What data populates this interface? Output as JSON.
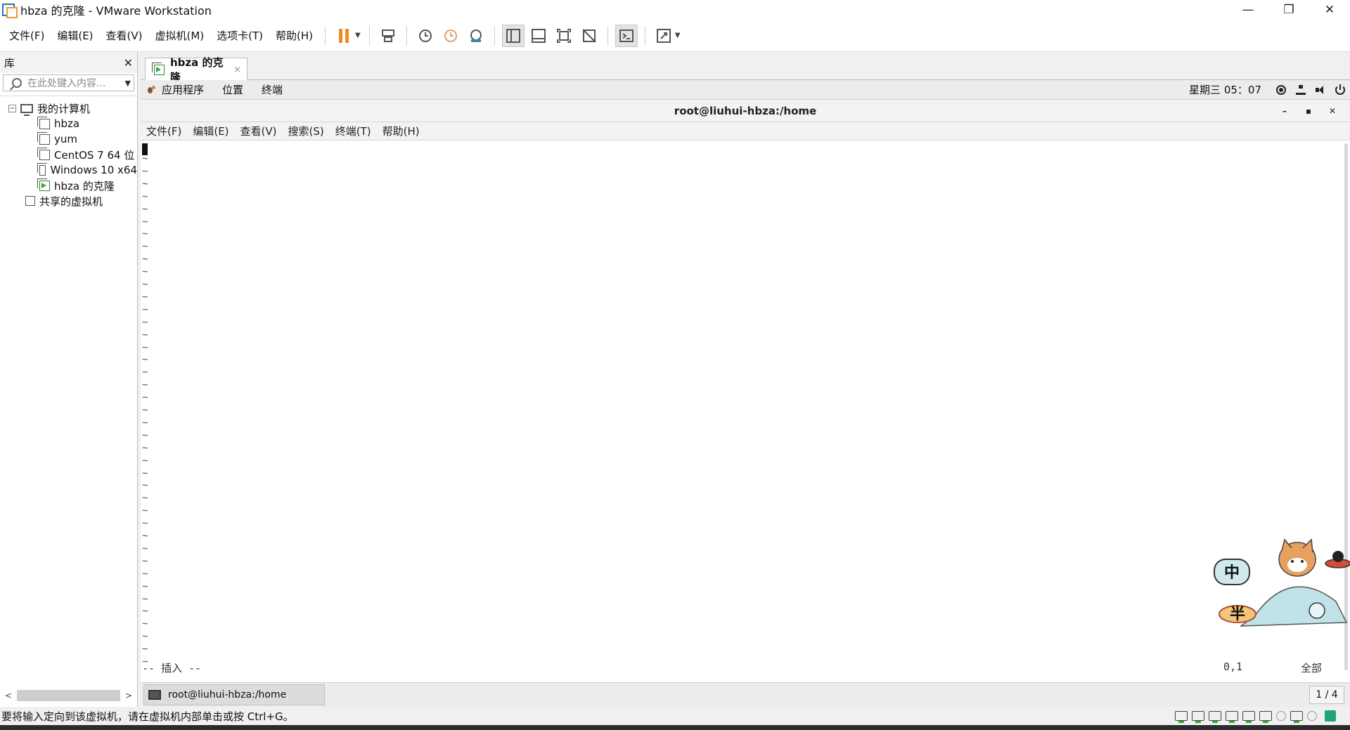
{
  "window": {
    "title": "hbza 的克隆 - VMware Workstation",
    "controls": {
      "minimize": "—",
      "restore": "❐",
      "close": "✕"
    }
  },
  "menu": {
    "items": [
      "文件(F)",
      "编辑(E)",
      "查看(V)",
      "虚拟机(M)",
      "选项卡(T)",
      "帮助(H)"
    ]
  },
  "toolbar": {
    "icons": [
      "pause-icon",
      "send-ctrl-alt-del-icon",
      "snapshot-icon",
      "revert-snapshot-icon",
      "snapshot-manager-icon",
      "library-view-icon",
      "thumbnail-view-icon",
      "fullscreen-icon",
      "unity-icon",
      "console-icon",
      "stretch-icon"
    ],
    "accent": "#f08a24"
  },
  "library": {
    "title": "库",
    "search_placeholder": "在此处键入内容...",
    "root": "我的计算机",
    "vms": [
      "hbza",
      "yum",
      "CentOS 7 64 位",
      "Windows 10 x64",
      "hbza 的克隆"
    ],
    "shared": "共享的虚拟机"
  },
  "tabs": [
    {
      "label": "hbza 的克隆",
      "close": "×"
    }
  ],
  "guest": {
    "top_bar": {
      "apps": "应用程序",
      "places": "位置",
      "terminal": "终端",
      "clock": "星期三 05：07"
    },
    "terminal": {
      "title": "root@liuhui-hbza:/home",
      "window_controls": [
        "–",
        "▪",
        "✕"
      ],
      "menu": [
        "文件(F)",
        "编辑(E)",
        "查看(V)",
        "搜索(S)",
        "终端(T)",
        "帮助(H)"
      ],
      "tilde": "~",
      "mode": "-- 插入 --",
      "position": "0,1",
      "scroll": "全部"
    },
    "ime": {
      "lang": "中",
      "width": "半"
    },
    "taskbar": {
      "item": "root@liuhui-hbza:/home",
      "workspace": "1 / 4"
    }
  },
  "statusbar": {
    "hint": "要将输入定向到该虚拟机，请在虚拟机内部单击或按 Ctrl+G。"
  }
}
